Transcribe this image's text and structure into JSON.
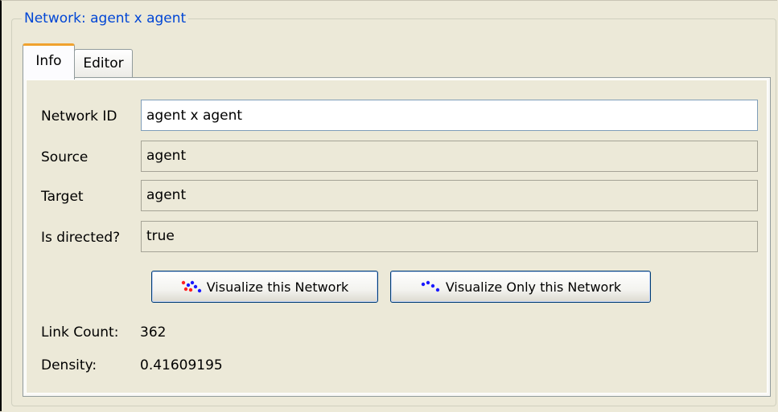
{
  "group": {
    "title": "Network: agent x agent"
  },
  "tabs": [
    {
      "label": "Info",
      "active": true
    },
    {
      "label": "Editor",
      "active": false
    }
  ],
  "form": {
    "network_id_label": "Network ID",
    "network_id_value": "agent x agent",
    "source_label": "Source",
    "source_value": "agent",
    "target_label": "Target",
    "target_value": "agent",
    "directed_label": "Is directed?",
    "directed_value": "true"
  },
  "buttons": {
    "visualize_label": "Visualize this Network",
    "visualize_only_label": "Visualize Only this Network"
  },
  "stats": {
    "link_count_label": "Link Count:",
    "link_count_value": "362",
    "density_label": "Density:",
    "density_value": "0.41609195"
  },
  "colors": {
    "group_title": "#0046d5",
    "tab_active_accent": "#f0a22e",
    "icon_red": "#ff2020",
    "icon_blue": "#1a1aff"
  }
}
